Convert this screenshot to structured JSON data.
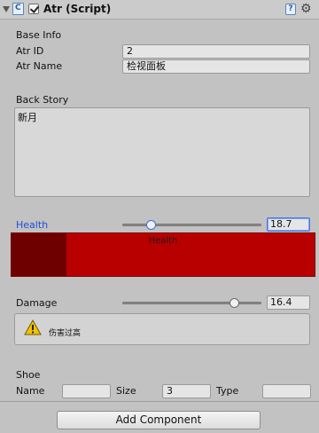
{
  "header": {
    "title": "Atr (Script)",
    "script_icon_letter": "C",
    "enabled": true,
    "help_icon_glyph": "?",
    "gear_icon_glyph": "⚙"
  },
  "base_info": {
    "heading": "Base Info",
    "atr_id_label": "Atr ID",
    "atr_id_value": "2",
    "atr_name_label": "Atr Name",
    "atr_name_value": "检视面板"
  },
  "back_story": {
    "label": "Back Story",
    "value": "新月"
  },
  "health": {
    "label": "Health",
    "value": "18.7",
    "slider_fraction": 0.25,
    "bar_label": "Health",
    "bar_color": "#b80000",
    "bar_dark_color": "#6e0000",
    "label_color": "#1d4fd4"
  },
  "damage": {
    "label": "Damage",
    "value": "16.4",
    "slider_fraction": 0.82,
    "warning_text": "伤害过高"
  },
  "shoe": {
    "heading": "Shoe",
    "name_label": "Name",
    "name_value": "",
    "size_label": "Size",
    "size_value": "3",
    "type_label": "Type",
    "type_value": ""
  },
  "footer": {
    "add_component_label": "Add Component"
  }
}
